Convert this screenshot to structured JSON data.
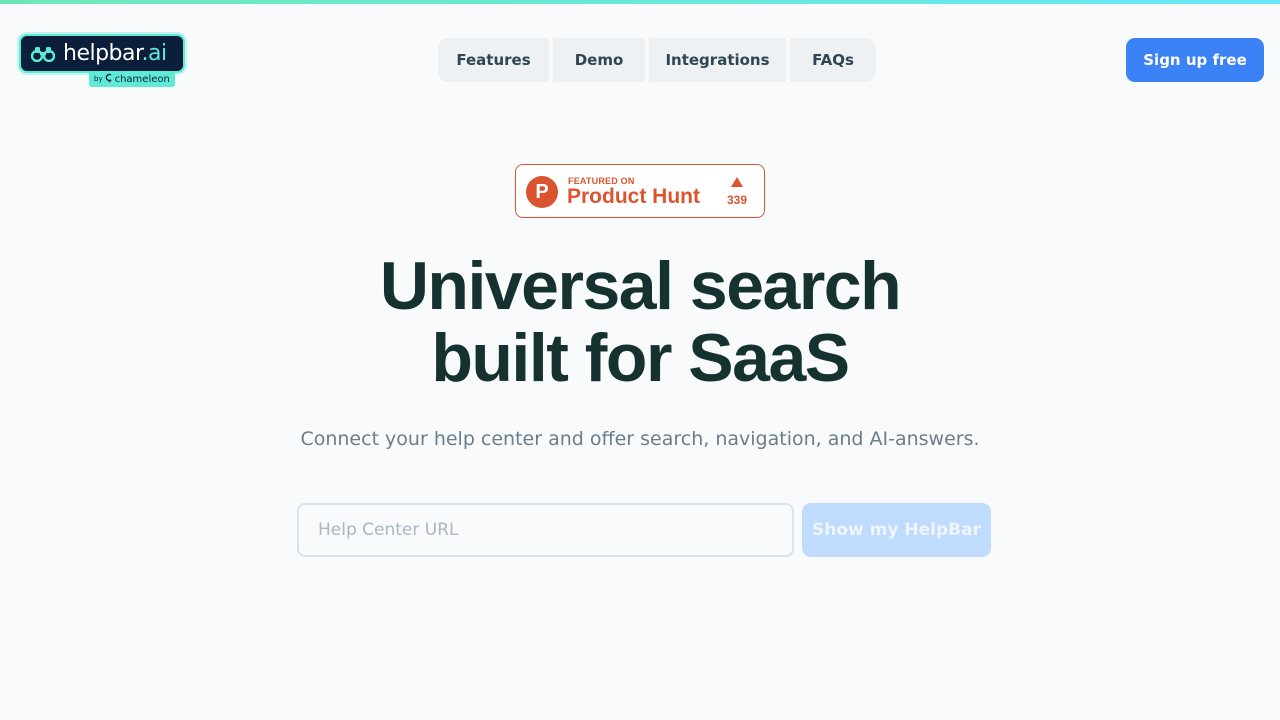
{
  "brand": {
    "name_main": "helpbar",
    "name_suffix": ".ai",
    "by_prefix": "by",
    "by_name": "chameleon",
    "accent_color": "#5eead4",
    "logo_bg_color": "#0b1f3a",
    "icon": "binoculars-icon"
  },
  "nav": {
    "items": [
      {
        "label": "Features"
      },
      {
        "label": "Demo"
      },
      {
        "label": "Integrations"
      },
      {
        "label": "FAQs"
      }
    ],
    "cta_label": "Sign up free",
    "cta_color": "#3b82f6"
  },
  "product_hunt": {
    "small_label": "FEATURED ON",
    "big_label": "Product Hunt",
    "logo_letter": "P",
    "upvotes": "339",
    "color": "#da552f"
  },
  "hero": {
    "title_line1": "Universal search",
    "title_line2": "built for SaaS",
    "subtitle": "Connect your help center and offer search, navigation, and AI-answers."
  },
  "form": {
    "url_placeholder": "Help Center URL",
    "url_value": "",
    "submit_label": "Show my HelpBar"
  }
}
